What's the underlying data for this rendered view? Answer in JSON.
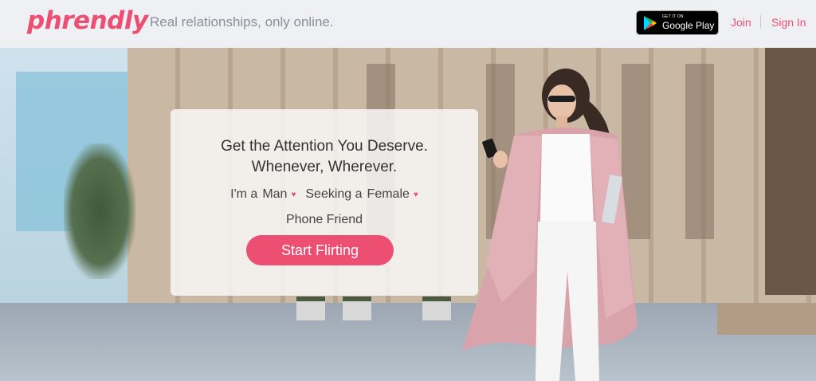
{
  "header": {
    "logo": "phrendly",
    "tagline": "Real relationships, only online.",
    "google_play": {
      "small": "GET IT ON",
      "big": "Google Play"
    },
    "join_label": "Join",
    "signin_label": "Sign In"
  },
  "hero": {
    "headline_line1": "Get the Attention You Deserve.",
    "headline_line2": "Whenever, Wherever.",
    "gender_prefix": "I'm a",
    "gender_value": "Man",
    "seeking_prefix": "Seeking a",
    "seeking_value": "Female",
    "relationship_value": "Phone Friend",
    "cta_label": "Start Flirting"
  },
  "colors": {
    "brand": "#ec4f72",
    "header_bg": "#eef0f3",
    "tagline": "#8a8f99"
  }
}
